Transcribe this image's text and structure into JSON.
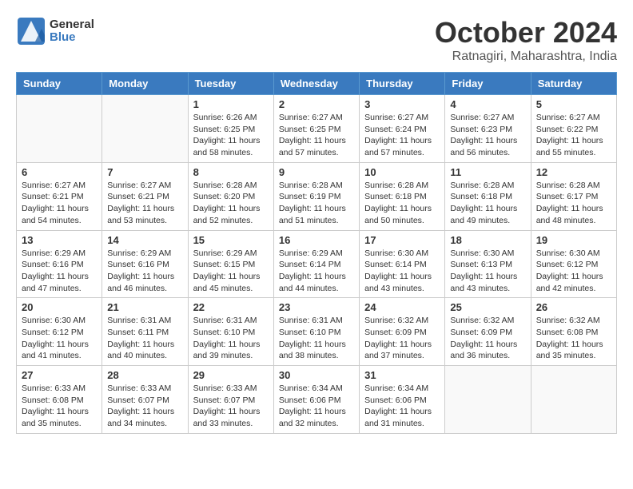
{
  "logo": {
    "text_general": "General",
    "text_blue": "Blue"
  },
  "title": {
    "month_year": "October 2024",
    "location": "Ratnagiri, Maharashtra, India"
  },
  "headers": [
    "Sunday",
    "Monday",
    "Tuesday",
    "Wednesday",
    "Thursday",
    "Friday",
    "Saturday"
  ],
  "weeks": [
    [
      {
        "day": "",
        "info": ""
      },
      {
        "day": "",
        "info": ""
      },
      {
        "day": "1",
        "info": "Sunrise: 6:26 AM\nSunset: 6:25 PM\nDaylight: 11 hours and 58 minutes."
      },
      {
        "day": "2",
        "info": "Sunrise: 6:27 AM\nSunset: 6:25 PM\nDaylight: 11 hours and 57 minutes."
      },
      {
        "day": "3",
        "info": "Sunrise: 6:27 AM\nSunset: 6:24 PM\nDaylight: 11 hours and 57 minutes."
      },
      {
        "day": "4",
        "info": "Sunrise: 6:27 AM\nSunset: 6:23 PM\nDaylight: 11 hours and 56 minutes."
      },
      {
        "day": "5",
        "info": "Sunrise: 6:27 AM\nSunset: 6:22 PM\nDaylight: 11 hours and 55 minutes."
      }
    ],
    [
      {
        "day": "6",
        "info": "Sunrise: 6:27 AM\nSunset: 6:21 PM\nDaylight: 11 hours and 54 minutes."
      },
      {
        "day": "7",
        "info": "Sunrise: 6:27 AM\nSunset: 6:21 PM\nDaylight: 11 hours and 53 minutes."
      },
      {
        "day": "8",
        "info": "Sunrise: 6:28 AM\nSunset: 6:20 PM\nDaylight: 11 hours and 52 minutes."
      },
      {
        "day": "9",
        "info": "Sunrise: 6:28 AM\nSunset: 6:19 PM\nDaylight: 11 hours and 51 minutes."
      },
      {
        "day": "10",
        "info": "Sunrise: 6:28 AM\nSunset: 6:18 PM\nDaylight: 11 hours and 50 minutes."
      },
      {
        "day": "11",
        "info": "Sunrise: 6:28 AM\nSunset: 6:18 PM\nDaylight: 11 hours and 49 minutes."
      },
      {
        "day": "12",
        "info": "Sunrise: 6:28 AM\nSunset: 6:17 PM\nDaylight: 11 hours and 48 minutes."
      }
    ],
    [
      {
        "day": "13",
        "info": "Sunrise: 6:29 AM\nSunset: 6:16 PM\nDaylight: 11 hours and 47 minutes."
      },
      {
        "day": "14",
        "info": "Sunrise: 6:29 AM\nSunset: 6:16 PM\nDaylight: 11 hours and 46 minutes."
      },
      {
        "day": "15",
        "info": "Sunrise: 6:29 AM\nSunset: 6:15 PM\nDaylight: 11 hours and 45 minutes."
      },
      {
        "day": "16",
        "info": "Sunrise: 6:29 AM\nSunset: 6:14 PM\nDaylight: 11 hours and 44 minutes."
      },
      {
        "day": "17",
        "info": "Sunrise: 6:30 AM\nSunset: 6:14 PM\nDaylight: 11 hours and 43 minutes."
      },
      {
        "day": "18",
        "info": "Sunrise: 6:30 AM\nSunset: 6:13 PM\nDaylight: 11 hours and 43 minutes."
      },
      {
        "day": "19",
        "info": "Sunrise: 6:30 AM\nSunset: 6:12 PM\nDaylight: 11 hours and 42 minutes."
      }
    ],
    [
      {
        "day": "20",
        "info": "Sunrise: 6:30 AM\nSunset: 6:12 PM\nDaylight: 11 hours and 41 minutes."
      },
      {
        "day": "21",
        "info": "Sunrise: 6:31 AM\nSunset: 6:11 PM\nDaylight: 11 hours and 40 minutes."
      },
      {
        "day": "22",
        "info": "Sunrise: 6:31 AM\nSunset: 6:10 PM\nDaylight: 11 hours and 39 minutes."
      },
      {
        "day": "23",
        "info": "Sunrise: 6:31 AM\nSunset: 6:10 PM\nDaylight: 11 hours and 38 minutes."
      },
      {
        "day": "24",
        "info": "Sunrise: 6:32 AM\nSunset: 6:09 PM\nDaylight: 11 hours and 37 minutes."
      },
      {
        "day": "25",
        "info": "Sunrise: 6:32 AM\nSunset: 6:09 PM\nDaylight: 11 hours and 36 minutes."
      },
      {
        "day": "26",
        "info": "Sunrise: 6:32 AM\nSunset: 6:08 PM\nDaylight: 11 hours and 35 minutes."
      }
    ],
    [
      {
        "day": "27",
        "info": "Sunrise: 6:33 AM\nSunset: 6:08 PM\nDaylight: 11 hours and 35 minutes."
      },
      {
        "day": "28",
        "info": "Sunrise: 6:33 AM\nSunset: 6:07 PM\nDaylight: 11 hours and 34 minutes."
      },
      {
        "day": "29",
        "info": "Sunrise: 6:33 AM\nSunset: 6:07 PM\nDaylight: 11 hours and 33 minutes."
      },
      {
        "day": "30",
        "info": "Sunrise: 6:34 AM\nSunset: 6:06 PM\nDaylight: 11 hours and 32 minutes."
      },
      {
        "day": "31",
        "info": "Sunrise: 6:34 AM\nSunset: 6:06 PM\nDaylight: 11 hours and 31 minutes."
      },
      {
        "day": "",
        "info": ""
      },
      {
        "day": "",
        "info": ""
      }
    ]
  ]
}
